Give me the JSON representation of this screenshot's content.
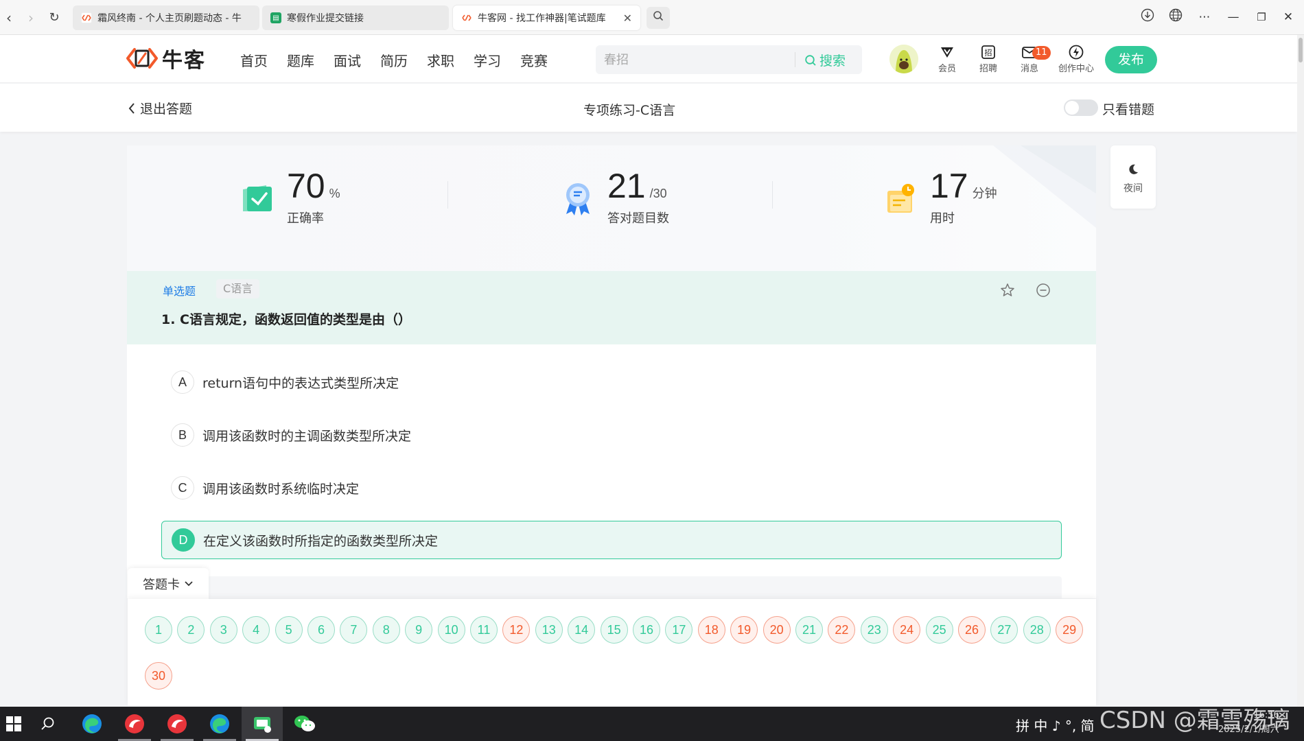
{
  "browser": {
    "tabs": [
      {
        "title": "霜风终南 - 个人主页刷题动态 - 牛",
        "active": false
      },
      {
        "title": "寒假作业提交链接",
        "active": false
      },
      {
        "title": "牛客网 - 找工作神器|笔试题库",
        "active": true
      }
    ]
  },
  "site": {
    "logo_text": "牛客",
    "nav": [
      "首页",
      "题库",
      "面试",
      "简历",
      "求职",
      "学习",
      "竞赛"
    ],
    "search": {
      "placeholder": "春招",
      "button": "搜索"
    },
    "icons": [
      {
        "label": "会员",
        "icon": "vip-icon"
      },
      {
        "label": "招聘",
        "icon": "recruit-icon"
      },
      {
        "label": "消息",
        "icon": "message-icon",
        "badge": "11"
      },
      {
        "label": "创作中心",
        "icon": "creator-icon"
      }
    ],
    "publish": "发布"
  },
  "subheader": {
    "back": "退出答题",
    "title": "专项练习-C语言",
    "toggle_label": "只看错题"
  },
  "night": {
    "label": "夜间"
  },
  "stats": [
    {
      "value": "70",
      "unit": "%",
      "label": "正确率"
    },
    {
      "value": "21",
      "unit": "/30",
      "label": "答对题目数"
    },
    {
      "value": "17",
      "unit": "分钟",
      "label": "用时"
    }
  ],
  "question": {
    "type": "单选题",
    "tag": "C语言",
    "title": "1. C语言规定，函数返回值的类型是由（）",
    "options": [
      {
        "letter": "A",
        "text": "return语句中的表达式类型所决定"
      },
      {
        "letter": "B",
        "text": "调用该函数时的主调函数类型所决定"
      },
      {
        "letter": "C",
        "text": "调用该函数时系统临时决定"
      },
      {
        "letter": "D",
        "text": "在定义该函数时所指定的函数类型所决定"
      }
    ],
    "selected": "D"
  },
  "answer_card": {
    "label": "答题卡",
    "items": [
      {
        "n": "1",
        "status": "right"
      },
      {
        "n": "2",
        "status": "right"
      },
      {
        "n": "3",
        "status": "right"
      },
      {
        "n": "4",
        "status": "right"
      },
      {
        "n": "5",
        "status": "right"
      },
      {
        "n": "6",
        "status": "right"
      },
      {
        "n": "7",
        "status": "right"
      },
      {
        "n": "8",
        "status": "right"
      },
      {
        "n": "9",
        "status": "right"
      },
      {
        "n": "10",
        "status": "right"
      },
      {
        "n": "11",
        "status": "right"
      },
      {
        "n": "12",
        "status": "wrong"
      },
      {
        "n": "13",
        "status": "right"
      },
      {
        "n": "14",
        "status": "right"
      },
      {
        "n": "15",
        "status": "right"
      },
      {
        "n": "16",
        "status": "right"
      },
      {
        "n": "17",
        "status": "right"
      },
      {
        "n": "18",
        "status": "wrong"
      },
      {
        "n": "19",
        "status": "wrong"
      },
      {
        "n": "20",
        "status": "wrong"
      },
      {
        "n": "21",
        "status": "right"
      },
      {
        "n": "22",
        "status": "wrong"
      },
      {
        "n": "23",
        "status": "right"
      },
      {
        "n": "24",
        "status": "wrong"
      },
      {
        "n": "25",
        "status": "right"
      },
      {
        "n": "26",
        "status": "wrong"
      },
      {
        "n": "27",
        "status": "right"
      },
      {
        "n": "28",
        "status": "right"
      },
      {
        "n": "29",
        "status": "wrong"
      },
      {
        "n": "30",
        "status": "wrong"
      }
    ]
  },
  "taskbar": {
    "ime": "拼 中 ♪ °, 简",
    "watermark": "CSDN @霜雪殇璃",
    "time": "16:56",
    "date": "2025/2/1/周六"
  },
  "colors": {
    "accent": "#32ca99",
    "wrong": "#f25a2b",
    "link": "#1f7de6"
  }
}
